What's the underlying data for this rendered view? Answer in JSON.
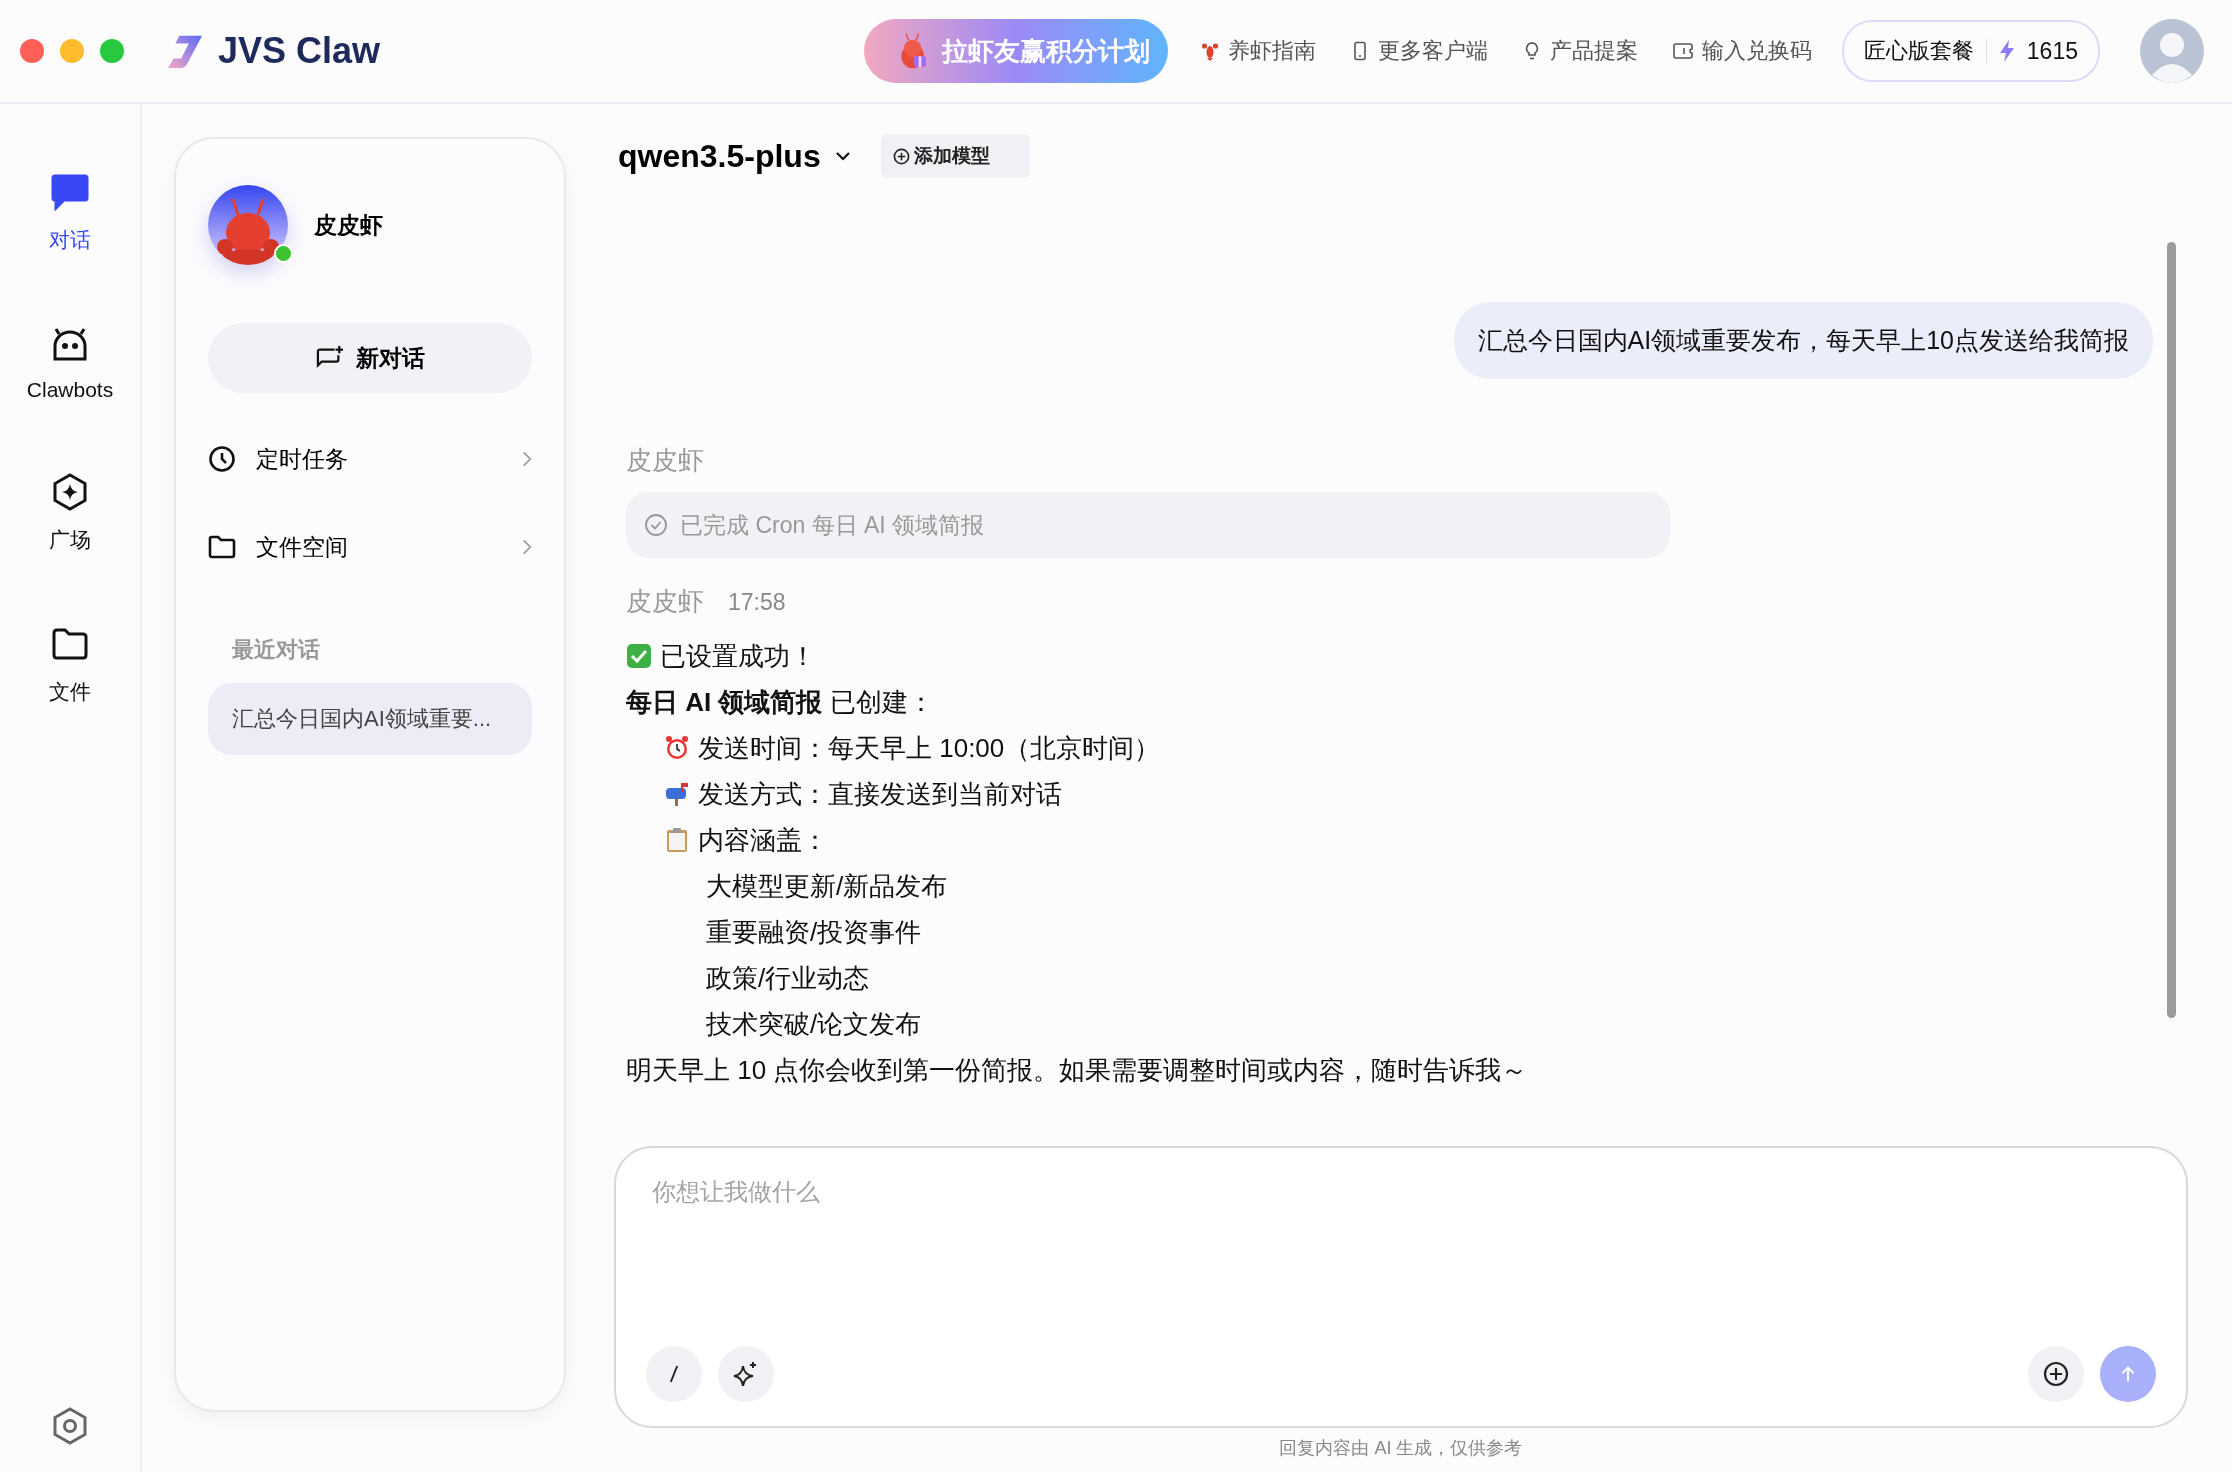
{
  "app": {
    "name": "JVS Claw"
  },
  "header": {
    "promo": "拉虾友赢积分计划",
    "links": [
      {
        "label": "养虾指南",
        "kind": "guide"
      },
      {
        "label": "更多客户端",
        "kind": "device"
      },
      {
        "label": "产品提案",
        "kind": "idea"
      },
      {
        "label": "输入兑换码",
        "kind": "ticket"
      }
    ],
    "plan": "匠心版套餐",
    "credits": "1615"
  },
  "rail": {
    "items": [
      {
        "label": "对话",
        "kind": "chat",
        "selected": true
      },
      {
        "label": "Clawbots",
        "kind": "bot",
        "selected": false
      },
      {
        "label": "广场",
        "kind": "plaza",
        "selected": false
      },
      {
        "label": "文件",
        "kind": "folder",
        "selected": false
      }
    ]
  },
  "panel": {
    "agent_name": "皮皮虾",
    "online": true,
    "new_chat": "新对话",
    "menu": [
      {
        "label": "定时任务",
        "kind": "clock"
      },
      {
        "label": "文件空间",
        "kind": "folder"
      }
    ],
    "recent_heading": "最近对话",
    "recent": [
      {
        "title": "汇总今日国内AI领域重要...",
        "selected": true
      }
    ]
  },
  "chat": {
    "model": "qwen3.5-plus",
    "add_model": "添加模型",
    "messages": [
      {
        "kind": "user",
        "text": "汇总今日国内AI领域重要发布，每天早上10点发送给我简报"
      },
      {
        "kind": "assistant",
        "sender": "皮皮虾",
        "tool": {
          "label": "已完成 Cron 每日 AI 领域简报",
          "done": true
        }
      },
      {
        "kind": "assistant",
        "sender": "皮皮虾",
        "time": "17:58",
        "lines": [
          {
            "kind": "success",
            "text": "已设置成功！"
          },
          {
            "kind": "heading",
            "text": "**每日 AI 领域简报** 已创建："
          },
          {
            "kind": "time",
            "text": "发送时间：每天早上 10:00（北京时间）"
          },
          {
            "kind": "delivery",
            "text": "发送方式：直接发送到当前对话"
          },
          {
            "kind": "scope",
            "text": "内容涵盖："
          },
          {
            "kind": "topic",
            "text": "大模型更新/新品发布"
          },
          {
            "kind": "topic",
            "text": "重要融资/投资事件"
          },
          {
            "kind": "topic",
            "text": "政策/行业动态"
          },
          {
            "kind": "topic",
            "text": "技术突破/论文发布"
          },
          {
            "kind": "closing",
            "text": "明天早上 10 点你会收到第一份简报。如果需要调整时间或内容，随时告诉我～"
          }
        ]
      }
    ]
  },
  "composer": {
    "placeholder": "你想让我做什么"
  },
  "disclaimer": "回复内容由 AI 生成，仅供参考"
}
